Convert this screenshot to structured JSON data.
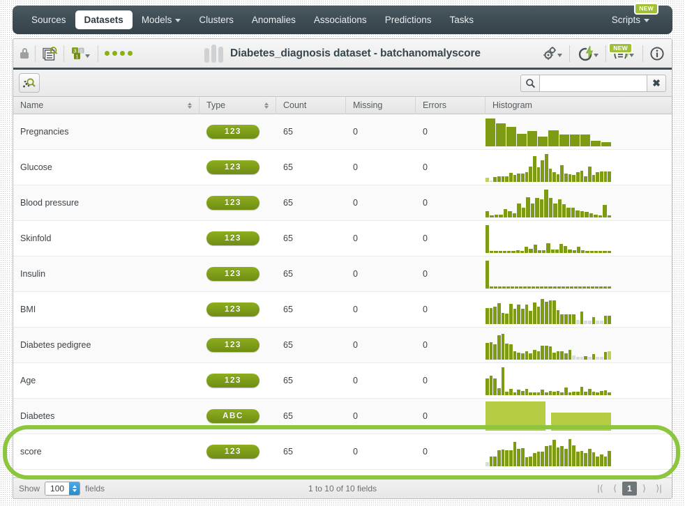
{
  "nav": {
    "items": [
      {
        "label": "Sources",
        "active": false,
        "dropdown": false
      },
      {
        "label": "Datasets",
        "active": true,
        "dropdown": false
      },
      {
        "label": "Models",
        "active": false,
        "dropdown": true
      },
      {
        "label": "Clusters",
        "active": false,
        "dropdown": false
      },
      {
        "label": "Anomalies",
        "active": false,
        "dropdown": false
      },
      {
        "label": "Associations",
        "active": false,
        "dropdown": false
      },
      {
        "label": "Predictions",
        "active": false,
        "dropdown": false
      },
      {
        "label": "Tasks",
        "active": false,
        "dropdown": false
      }
    ],
    "scripts_label": "Scripts",
    "scripts_badge": "NEW"
  },
  "titlebar": {
    "title": "Diabetes_diagnosis dataset - batchanomalyscore",
    "lock_icon": "lock-icon",
    "dataset_view_icon": "dataset-inspect-icon",
    "field_types_icon": "field-types-icon",
    "status_dots": 4,
    "config_icon": "gears-icon",
    "rebuild_icon": "lightning-icon",
    "batch_icon": "batch-script-icon",
    "batch_badge": "NEW",
    "info_icon": "info-icon"
  },
  "toolbar": {
    "scatterplot_icon": "scatterplot-search-icon",
    "search_icon": "search-icon",
    "search_value": "",
    "search_placeholder": "",
    "clear_icon": "clear-icon"
  },
  "table": {
    "columns": [
      {
        "key": "name",
        "label": "Name",
        "sortable": true
      },
      {
        "key": "type",
        "label": "Type",
        "sortable": true
      },
      {
        "key": "count",
        "label": "Count",
        "sortable": false
      },
      {
        "key": "missing",
        "label": "Missing",
        "sortable": false
      },
      {
        "key": "errors",
        "label": "Errors",
        "sortable": false
      },
      {
        "key": "histogram",
        "label": "Histogram",
        "sortable": false
      }
    ],
    "rows": [
      {
        "name": "Pregnancies",
        "type": "123",
        "count": "65",
        "missing": "0",
        "errors": "0",
        "highlighted": false,
        "hist_type": "numeric",
        "histogram": [
          100,
          82,
          70,
          44,
          56,
          36,
          58,
          42,
          42,
          42,
          20,
          16
        ]
      },
      {
        "name": "Glucose",
        "type": "123",
        "count": "65",
        "missing": "0",
        "errors": "0",
        "highlighted": false,
        "hist_type": "numeric",
        "histogram": [
          16,
          6,
          18,
          20,
          20,
          20,
          32,
          26,
          30,
          30,
          34,
          56,
          92,
          52,
          78,
          100,
          48,
          34,
          28,
          60,
          30,
          28,
          26,
          34,
          40,
          20,
          54,
          26,
          34,
          38,
          38,
          38
        ],
        "hist_flags": [
          "pale",
          "light",
          "",
          "",
          "",
          "",
          "",
          "",
          "",
          "",
          "",
          "",
          "",
          "",
          "",
          "",
          "",
          "",
          "",
          "",
          "",
          "",
          "",
          "",
          "",
          "",
          "",
          "",
          "",
          "",
          "",
          ""
        ]
      },
      {
        "name": "Blood pressure",
        "type": "123",
        "count": "65",
        "missing": "0",
        "errors": "0",
        "highlighted": false,
        "hist_type": "numeric",
        "histogram": [
          22,
          8,
          10,
          10,
          30,
          22,
          14,
          50,
          36,
          72,
          50,
          70,
          64,
          100,
          70,
          50,
          66,
          48,
          34,
          34,
          24,
          22,
          20,
          16,
          10,
          8,
          46,
          8
        ]
      },
      {
        "name": "Skinfold",
        "type": "123",
        "count": "65",
        "missing": "0",
        "errors": "0",
        "highlighted": false,
        "hist_type": "numeric",
        "histogram": [
          100,
          8,
          8,
          8,
          8,
          8,
          8,
          10,
          8,
          22,
          14,
          30,
          10,
          10,
          34,
          12,
          12,
          32,
          26,
          12,
          10,
          22,
          10,
          8,
          8,
          8,
          8,
          8,
          8
        ]
      },
      {
        "name": "Insulin",
        "type": "123",
        "count": "65",
        "missing": "0",
        "errors": "0",
        "highlighted": false,
        "hist_type": "numeric",
        "histogram": [
          100,
          8,
          8,
          8,
          8,
          8,
          8,
          8,
          8,
          8,
          8,
          8,
          8,
          8,
          8,
          8,
          8,
          8,
          8,
          8,
          8,
          8,
          8,
          8,
          8,
          8,
          8,
          8,
          8,
          8
        ]
      },
      {
        "name": "BMI",
        "type": "123",
        "count": "65",
        "missing": "0",
        "errors": "0",
        "highlighted": false,
        "hist_type": "numeric",
        "histogram": [
          58,
          58,
          62,
          76,
          40,
          38,
          72,
          54,
          70,
          54,
          70,
          48,
          78,
          62,
          90,
          80,
          86,
          86,
          50,
          36,
          34,
          34,
          34,
          14,
          44,
          12,
          12,
          26,
          12,
          12,
          30,
          30
        ],
        "hist_flags": [
          "",
          "",
          "",
          "",
          "",
          "",
          "",
          "",
          "",
          "",
          "",
          "",
          "",
          "",
          "",
          "",
          "",
          "",
          "",
          "",
          "",
          "",
          "",
          "light",
          "",
          "light",
          "light",
          "",
          "light",
          "light",
          "",
          ""
        ]
      },
      {
        "name": "Diabetes pedigree",
        "type": "123",
        "count": "65",
        "missing": "0",
        "errors": "0",
        "highlighted": false,
        "hist_type": "numeric",
        "histogram": [
          60,
          62,
          56,
          88,
          92,
          58,
          56,
          30,
          26,
          22,
          30,
          22,
          34,
          30,
          50,
          50,
          48,
          26,
          30,
          30,
          22,
          36,
          14,
          10,
          10,
          12,
          10,
          20,
          10,
          10,
          28,
          30
        ],
        "hist_flags": [
          "",
          "",
          "",
          "",
          "",
          "",
          "",
          "",
          "",
          "",
          "",
          "",
          "",
          "",
          "",
          "",
          "",
          "",
          "",
          "",
          "",
          "",
          "light",
          "light",
          "light",
          "",
          "light",
          "",
          "light",
          "light",
          "",
          "pale"
        ]
      },
      {
        "name": "Age",
        "type": "123",
        "count": "65",
        "missing": "0",
        "errors": "0",
        "highlighted": false,
        "hist_type": "numeric",
        "histogram": [
          60,
          70,
          60,
          26,
          100,
          12,
          22,
          10,
          20,
          14,
          22,
          10,
          10,
          10,
          20,
          10,
          14,
          12,
          16,
          10,
          28,
          10,
          12,
          12,
          30,
          12,
          22,
          12,
          10,
          14,
          18,
          10
        ]
      },
      {
        "name": "Diabetes",
        "type": "ABC",
        "count": "65",
        "missing": "0",
        "errors": "0",
        "highlighted": false,
        "hist_type": "categorical",
        "histogram": [
          100,
          62
        ],
        "hist_widths": [
          90,
          90
        ]
      },
      {
        "name": "score",
        "type": "123",
        "count": "65",
        "missing": "0",
        "errors": "0",
        "highlighted": true,
        "hist_type": "numeric",
        "histogram": [
          14,
          34,
          36,
          58,
          60,
          58,
          58,
          88,
          62,
          66,
          32,
          36,
          48,
          52,
          52,
          72,
          74,
          96,
          68,
          72,
          62,
          98,
          76,
          52,
          56,
          48,
          62,
          50,
          34,
          42,
          36,
          56
        ],
        "hist_flags": [
          "light",
          "",
          "",
          "",
          "",
          "",
          "",
          "",
          "",
          "",
          "",
          "",
          "",
          "",
          "",
          "",
          "",
          "",
          "",
          "",
          "",
          "",
          "",
          "",
          "",
          "",
          "",
          "",
          "",
          "",
          "",
          ""
        ]
      }
    ]
  },
  "footer": {
    "show_label": "Show",
    "show_value": "100",
    "fields_label": "fields",
    "range_text": "1 to 10 of 10 fields",
    "pager": {
      "first": "|⟨",
      "prev": "⟨",
      "current": "1",
      "next": "⟩",
      "last": "⟩|"
    }
  },
  "chart_data": {
    "type": "table",
    "title": "Diabetes_diagnosis dataset - batchanomalyscore",
    "columns": [
      "Name",
      "Type",
      "Count",
      "Missing",
      "Errors",
      "Histogram"
    ],
    "rows": [
      [
        "Pregnancies",
        "123",
        65,
        0,
        0,
        "numeric-histogram"
      ],
      [
        "Glucose",
        "123",
        65,
        0,
        0,
        "numeric-histogram"
      ],
      [
        "Blood pressure",
        "123",
        65,
        0,
        0,
        "numeric-histogram"
      ],
      [
        "Skinfold",
        "123",
        65,
        0,
        0,
        "numeric-histogram"
      ],
      [
        "Insulin",
        "123",
        65,
        0,
        0,
        "numeric-histogram"
      ],
      [
        "BMI",
        "123",
        65,
        0,
        0,
        "numeric-histogram"
      ],
      [
        "Diabetes pedigree",
        "123",
        65,
        0,
        0,
        "numeric-histogram"
      ],
      [
        "Age",
        "123",
        65,
        0,
        0,
        "numeric-histogram"
      ],
      [
        "Diabetes",
        "ABC",
        65,
        0,
        0,
        "categorical-histogram"
      ],
      [
        "score",
        "123",
        65,
        0,
        0,
        "numeric-histogram"
      ]
    ]
  }
}
